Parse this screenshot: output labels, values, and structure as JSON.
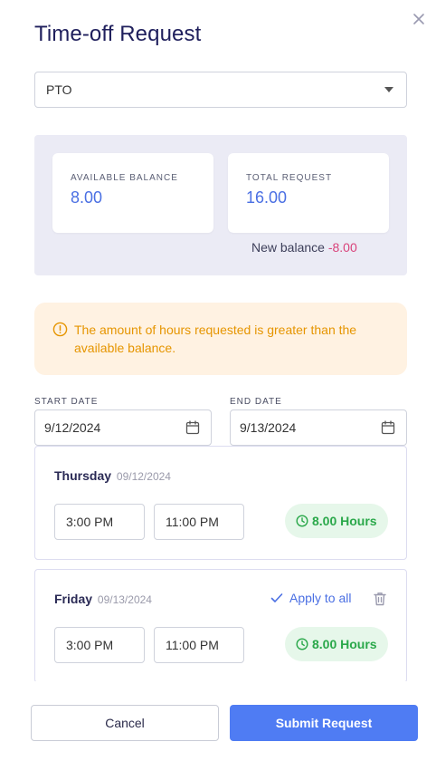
{
  "modal": {
    "title": "Time-off Request",
    "close_icon": "close-icon"
  },
  "leave_type": {
    "selected": "PTO"
  },
  "balance": {
    "available_label": "AVAILABLE BALANCE",
    "available_value": "8.00",
    "total_label": "TOTAL REQUEST",
    "total_value": "16.00",
    "new_balance_label": "New balance",
    "new_balance_value": "-8.00"
  },
  "warning": {
    "icon": "alert-circle-icon",
    "text": "The amount of hours requested is greater than the available balance."
  },
  "dates": {
    "start_label": "START DATE",
    "start_value": "9/12/2024",
    "end_label": "END DATE",
    "end_value": "9/13/2024"
  },
  "days": [
    {
      "name": "Thursday",
      "date": "09/12/2024",
      "start_time": "3:00 PM",
      "end_time": "11:00 PM",
      "hours": "8.00 Hours"
    },
    {
      "name": "Friday",
      "date": "09/13/2024",
      "start_time": "3:00 PM",
      "end_time": "11:00 PM",
      "hours": "8.00 Hours",
      "apply_all_label": "Apply to all"
    }
  ],
  "footer": {
    "cancel_label": "Cancel",
    "submit_label": "Submit Request"
  },
  "colors": {
    "accent": "#4f7cf3",
    "warning": "#e69500",
    "success": "#2aa84a",
    "negative": "#d9427a"
  }
}
